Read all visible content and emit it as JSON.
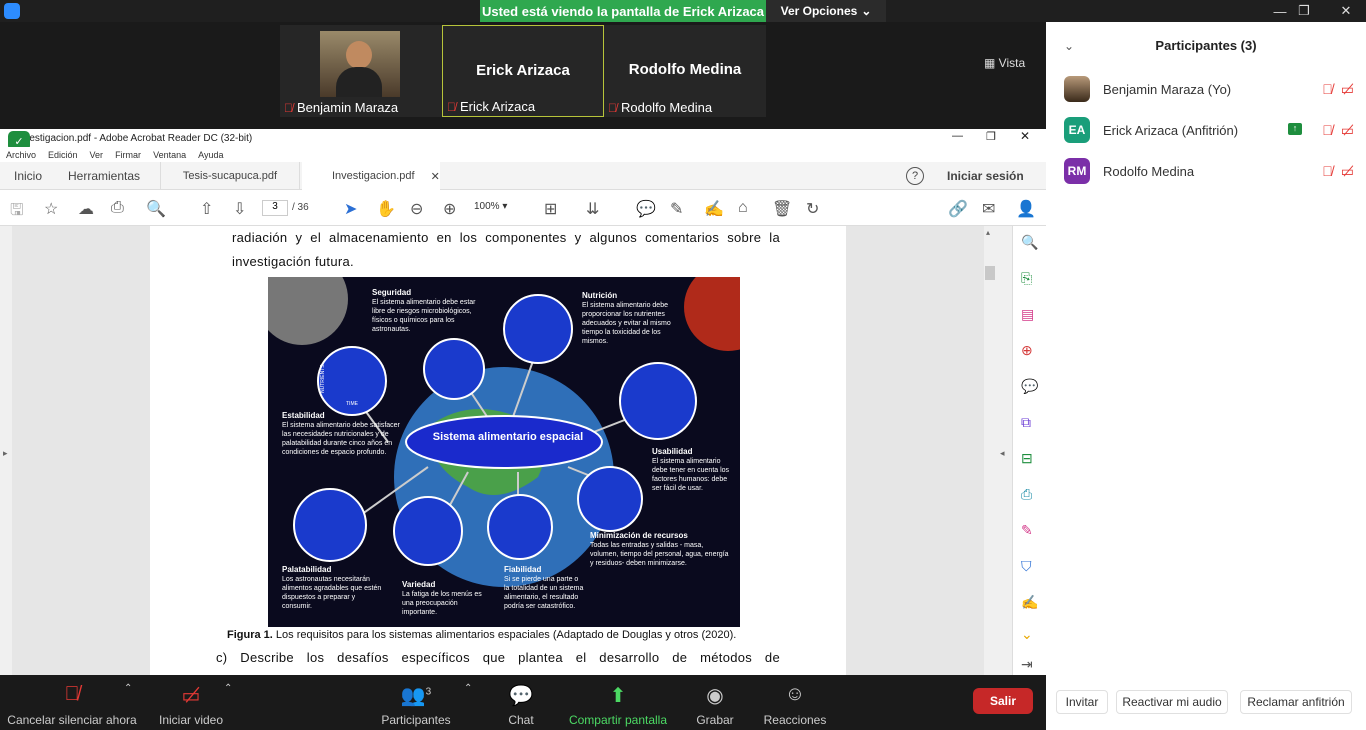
{
  "top_banner": {
    "text": "Usted está viendo la pantalla de Erick Arizaca",
    "view_options": "Ver Opciones"
  },
  "video_tiles": [
    {
      "name": "Benjamin Maraza",
      "big_name": ""
    },
    {
      "name": "Erick Arizaca",
      "big_name": "Erick Arizaca"
    },
    {
      "name": "Rodolfo Medina",
      "big_name": "Rodolfo Medina"
    }
  ],
  "vista_label": "Vista",
  "acrobat": {
    "title": "Investigacion.pdf - Adobe Acrobat Reader DC (32-bit)",
    "menu": [
      "Archivo",
      "Edición",
      "Ver",
      "Firmar",
      "Ventana",
      "Ayuda"
    ],
    "tabs": {
      "home": "Inicio",
      "tools": "Herramientas",
      "doc1": "Tesis-sucapuca.pdf",
      "doc2": "Investigacion.pdf",
      "signin": "Iniciar sesión"
    },
    "page_current": "3",
    "page_total": "/ 36",
    "zoom": "100%"
  },
  "document": {
    "line1": "radiación y el almacenamiento en los componentes y algunos comentarios sobre la",
    "line2": "investigación futura.",
    "caption_bold": "Figura 1.",
    "caption": "Los requisitos para los sistemas alimentarios espaciales (Adaptado de Douglas y otros (2020).",
    "line3": "c) Describe los desafíos específicos que plantea el desarrollo de métodos de"
  },
  "figure": {
    "center": "Sistema alimentario espacial",
    "seguridad_t": "Seguridad",
    "seguridad": "El sistema alimentario debe estar libre de riesgos microbiológicos, físicos o químicos para los astronautas.",
    "nutricion_t": "Nutrición",
    "nutricion": "El sistema alimentario debe proporcionar los nutrientes adecuados y evitar al mismo tiempo la toxicidad de los mismos.",
    "estabilidad_t": "Estabilidad",
    "estabilidad": "El sistema alimentario debe satisfacer las necesidades nutricionales y de palatabilidad durante cinco años en condiciones de espacio profundo.",
    "usabilidad_t": "Usabilidad",
    "usabilidad": "El sistema alimentario debe tener en cuenta los factores humanos: debe ser fácil de usar.",
    "minimizacion_t": "Minimización de recursos",
    "minimizacion": "Todas las entradas y salidas - masa, volumen, tiempo del personal, agua, energía y residuos- deben minimizarse.",
    "palatabilidad_t": "Palatabilidad",
    "palatabilidad": "Los astronautas necesitarán alimentos agradables que estén dispuestos a preparar y consumir.",
    "variedad_t": "Variedad",
    "variedad": "La fatiga de los menús es una preocupación importante.",
    "fiabilidad_t": "Fiabilidad",
    "fiabilidad": "Si se pierde una parte o la totalidad de un sistema alimentario, el resultado podría ser catastrófico.",
    "nutrients": "NUTRIENTS",
    "time": "TIME"
  },
  "participants": {
    "title": "Participantes (3)",
    "list": [
      {
        "initials": "",
        "name": "Benjamin Maraza (Yo)",
        "color": "#8a6a4a"
      },
      {
        "initials": "EA",
        "name": "Erick Arizaca (Anfitrión)",
        "color": "#1a9e7a"
      },
      {
        "initials": "RM",
        "name": "Rodolfo Medina",
        "color": "#7b2fa8"
      }
    ],
    "buttons": {
      "invite": "Invitar",
      "reactivate": "Reactivar mi audio",
      "claim": "Reclamar anfitrión"
    }
  },
  "zoom_toolbar": {
    "mute": "Cancelar silenciar ahora",
    "video": "Iniciar video",
    "participants": "Participantes",
    "participants_count": "3",
    "chat": "Chat",
    "share": "Compartir pantalla",
    "record": "Grabar",
    "reactions": "Reacciones",
    "leave": "Salir"
  }
}
